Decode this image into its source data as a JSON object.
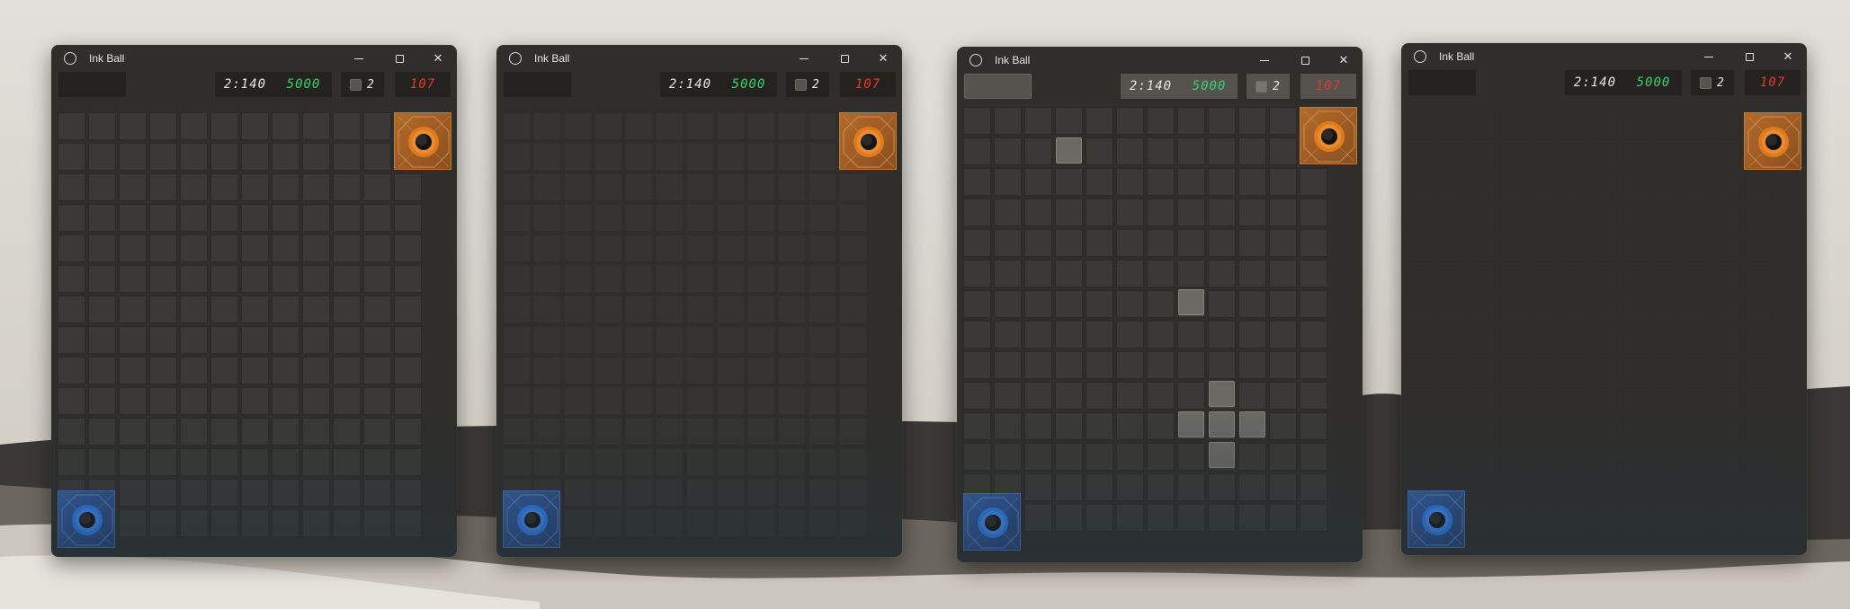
{
  "windows": [
    {
      "title": "Ink Ball",
      "lcd_time": "2:140",
      "lcd_score": "5000",
      "checkbox_count": "2",
      "lcd_red": "107"
    },
    {
      "title": "Ink Ball",
      "lcd_time": "2:140",
      "lcd_score": "5000",
      "checkbox_count": "2",
      "lcd_red": "107"
    },
    {
      "title": "Ink Ball",
      "lcd_time": "2:140",
      "lcd_score": "5000",
      "checkbox_count": "2",
      "lcd_red": "107"
    },
    {
      "title": "Ink Ball",
      "lcd_time": "2:140",
      "lcd_score": "5000",
      "checkbox_count": "2",
      "lcd_red": "107"
    }
  ],
  "colors": {
    "lcd_white": "#e8e8e8",
    "lcd_green": "#3fcf6e",
    "lcd_red": "#e23b2e",
    "orange_hole": "#b36a2a",
    "blue_hole": "#3560a9"
  },
  "icons": {
    "app": "circle-icon",
    "minimize": "minimize-icon",
    "maximize": "maximize-icon",
    "close": "close-icon"
  }
}
